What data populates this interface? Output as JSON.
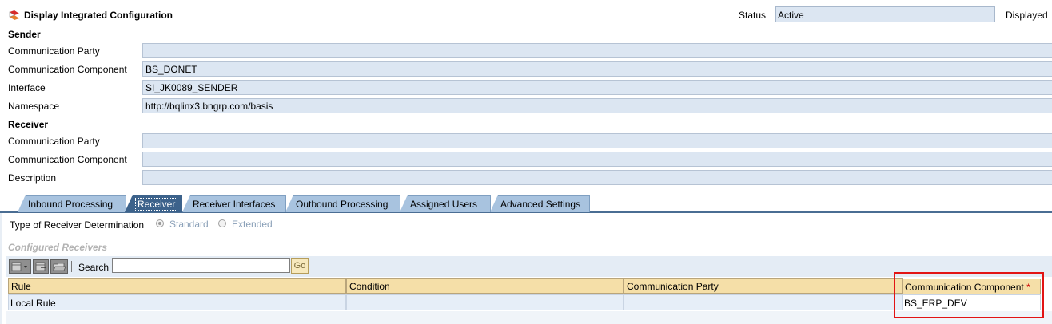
{
  "header": {
    "title": "Display Integrated Configuration",
    "status_label": "Status",
    "status_value": "Active",
    "displayed_label": "Displayed"
  },
  "sender": {
    "section_title": "Sender",
    "fields": [
      {
        "label": "Communication Party",
        "value": ""
      },
      {
        "label": "Communication Component",
        "value": "BS_DONET"
      },
      {
        "label": "Interface",
        "value": "SI_JK0089_SENDER"
      },
      {
        "label": "Namespace",
        "value": "http://bqlinx3.bngrp.com/basis"
      }
    ]
  },
  "receiver": {
    "section_title": "Receiver",
    "fields": [
      {
        "label": "Communication Party",
        "value": ""
      },
      {
        "label": "Communication Component",
        "value": ""
      },
      {
        "label": "Description",
        "value": ""
      }
    ]
  },
  "tabs": [
    {
      "label": "Inbound Processing",
      "active": false
    },
    {
      "label": "Receiver",
      "active": true
    },
    {
      "label": "Receiver Interfaces",
      "active": false
    },
    {
      "label": "Outbound Processing",
      "active": false
    },
    {
      "label": "Assigned Users",
      "active": false
    },
    {
      "label": "Advanced Settings",
      "active": false
    }
  ],
  "receiver_tab": {
    "determination_label": "Type of Receiver Determination",
    "options": [
      {
        "label": "Standard",
        "selected": true
      },
      {
        "label": "Extended",
        "selected": false
      }
    ],
    "configured_receivers_title": "Configured Receivers",
    "toolbar": {
      "search_label": "Search",
      "search_value": "",
      "go_label": "Go",
      "icons": [
        "add-row-icon",
        "delete-row-icon",
        "open-folder-icon"
      ]
    },
    "table": {
      "columns": [
        "Rule",
        "Condition",
        "Communication Party",
        "Communication Component"
      ],
      "required_marker": "*",
      "rows": [
        {
          "rule": "Local Rule",
          "condition": "",
          "party": "",
          "component": "BS_ERP_DEV"
        }
      ]
    }
  },
  "colors": {
    "field_bg": "#dce6f2",
    "tab_active": "#3c628b",
    "tab_inactive": "#a8c3df",
    "header_row": "#f5dfa8",
    "highlight": "#e21414"
  }
}
